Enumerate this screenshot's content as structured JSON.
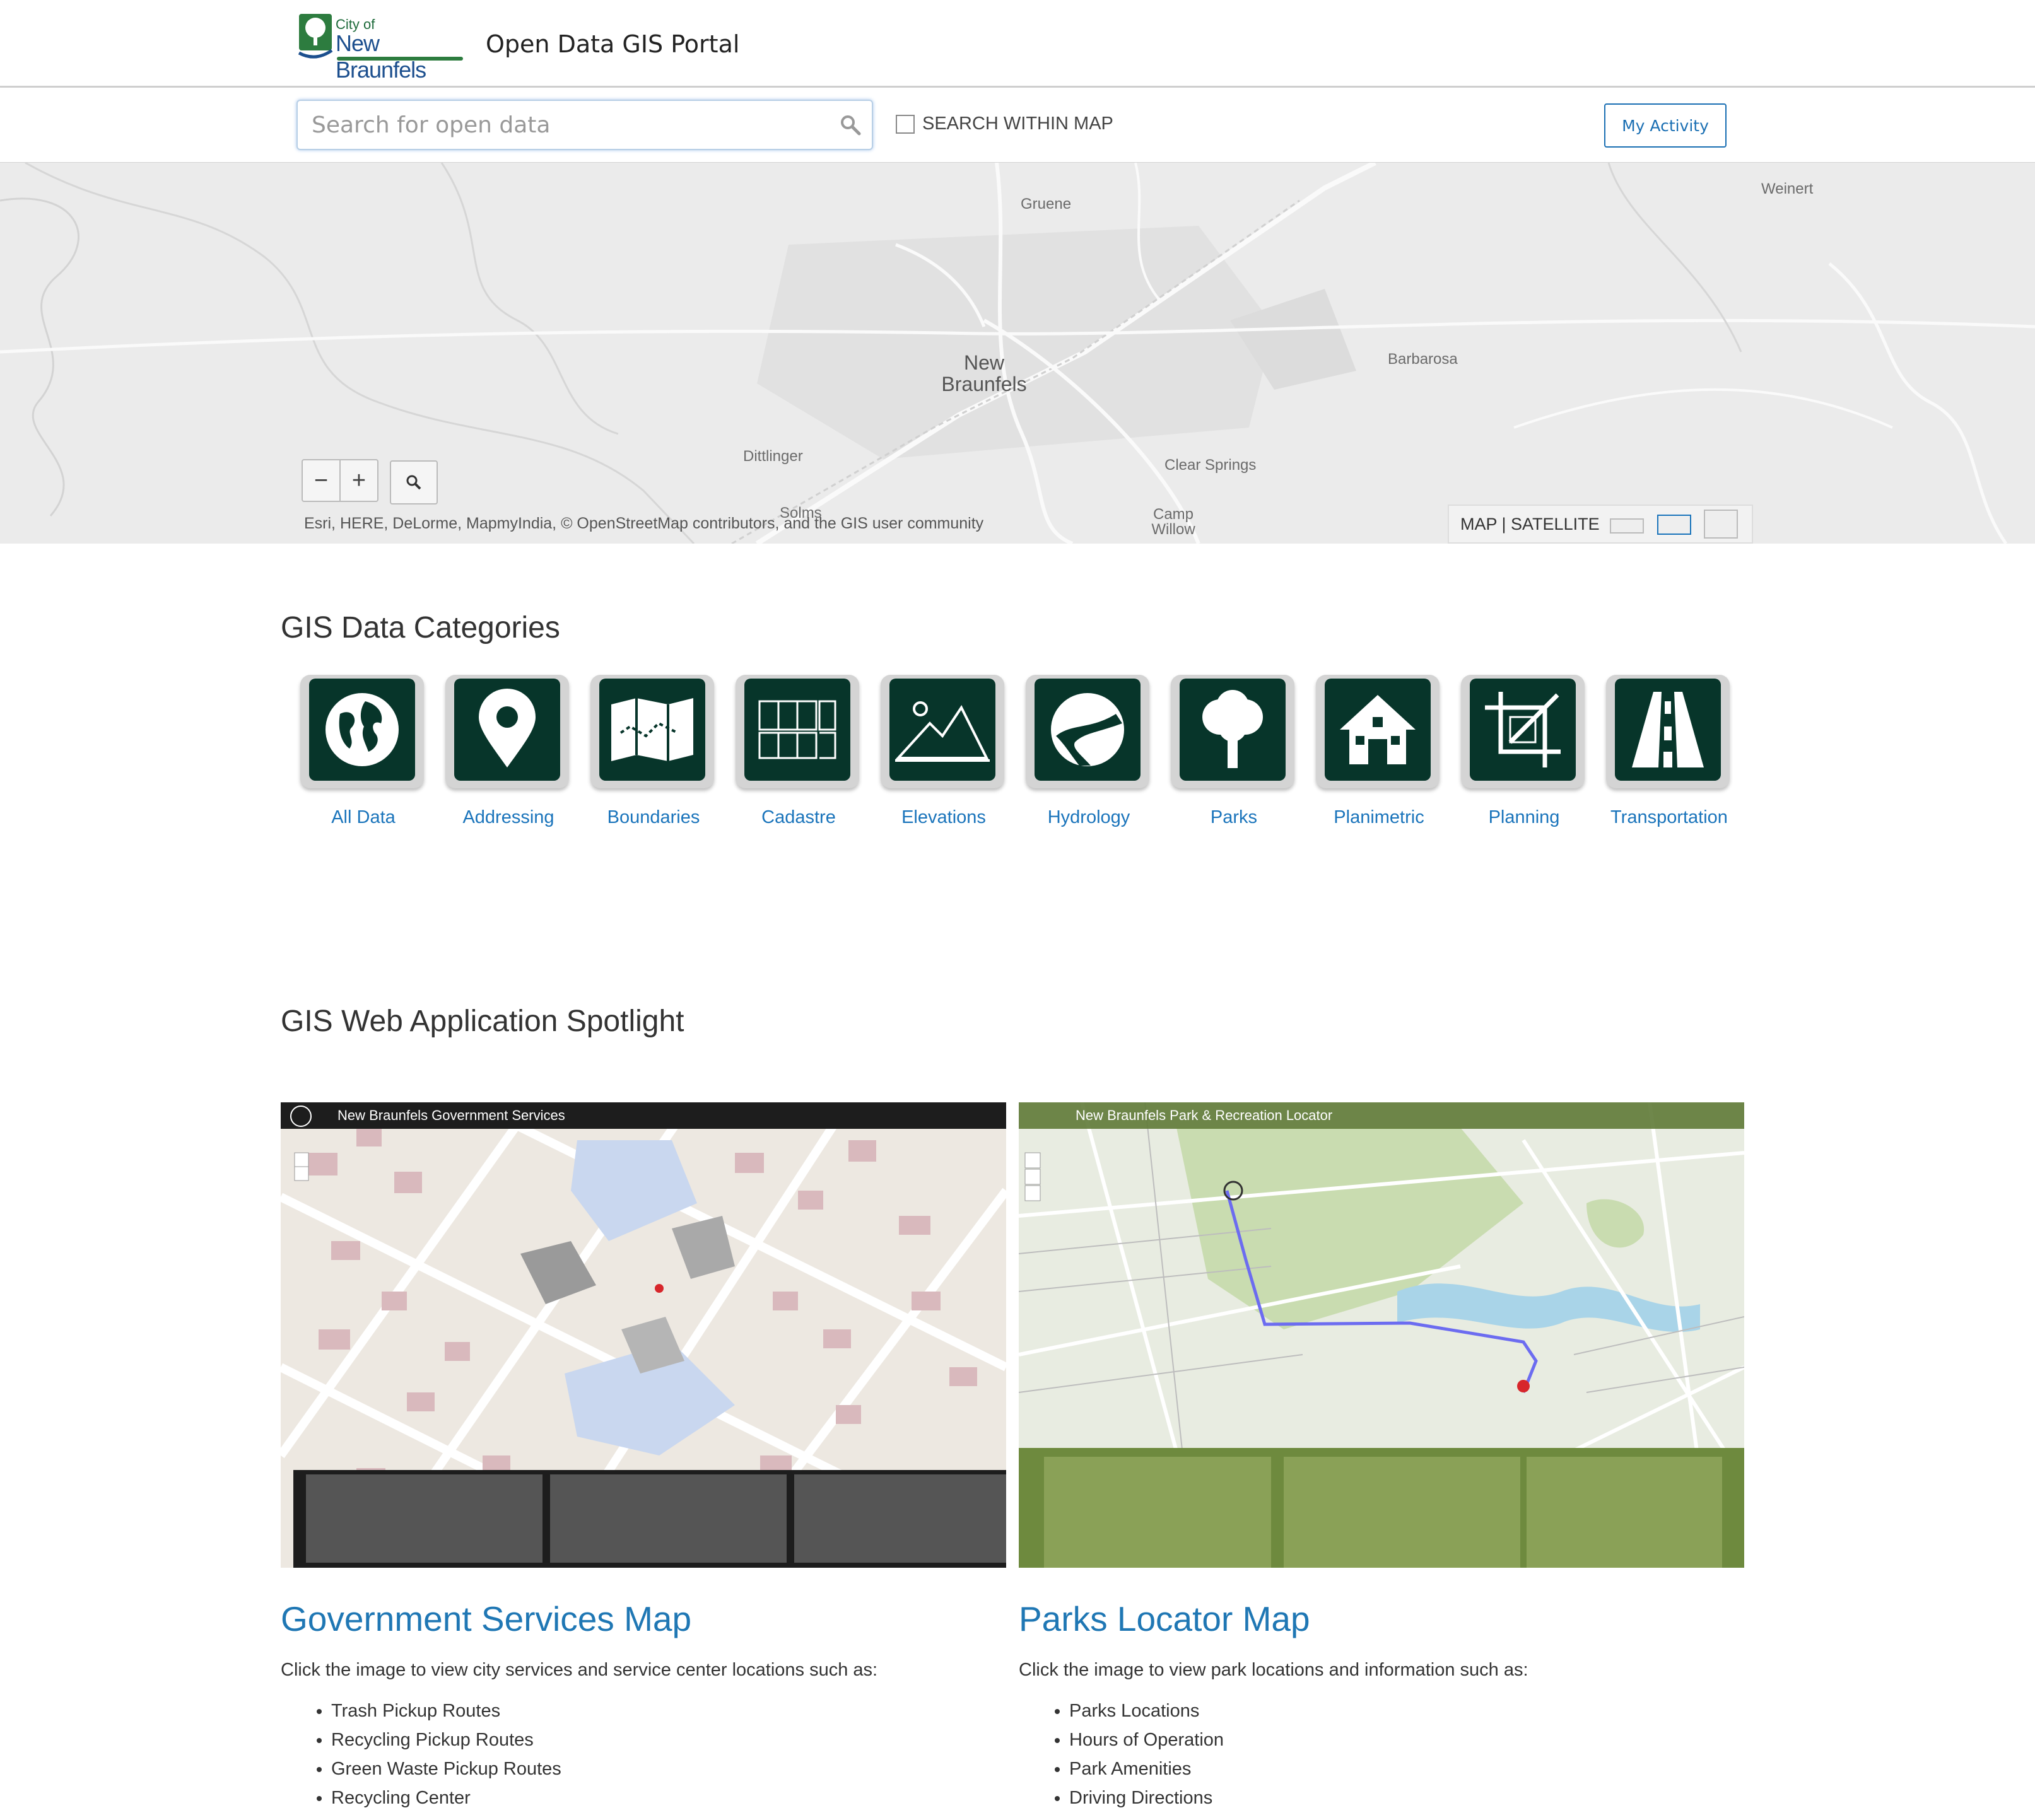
{
  "header": {
    "logo_line1": "City of",
    "logo_line2": "New Braunfels",
    "title": "Open Data GIS Portal"
  },
  "search": {
    "placeholder": "Search for open data",
    "within_map_label": "SEARCH WITHIN MAP",
    "my_activity_label": "My Activity"
  },
  "map": {
    "places": [
      "Gruene",
      "Weinert",
      "New Braunfels",
      "Barbarosa",
      "Dittlinger",
      "Clear Springs",
      "Solms",
      "Camp Willow"
    ],
    "zoom_out": "−",
    "zoom_in": "+",
    "attribution": "Esri, HERE, DeLorme, MapmyIndia, © OpenStreetMap contributors, and the GIS user community",
    "basemap_toggle": "MAP | SATELLITE"
  },
  "categories": {
    "title": "GIS Data Categories",
    "items": [
      {
        "label": "All Data",
        "icon": "globe-icon"
      },
      {
        "label": "Addressing",
        "icon": "map-pin-icon"
      },
      {
        "label": "Boundaries",
        "icon": "folded-map-icon"
      },
      {
        "label": "Cadastre",
        "icon": "parcel-grid-icon"
      },
      {
        "label": "Elevations",
        "icon": "mountain-icon"
      },
      {
        "label": "Hydrology",
        "icon": "river-icon"
      },
      {
        "label": "Parks",
        "icon": "tree-icon"
      },
      {
        "label": "Planimetric",
        "icon": "house-icon"
      },
      {
        "label": "Planning",
        "icon": "crop-icon"
      },
      {
        "label": "Transportation",
        "icon": "road-icon"
      }
    ]
  },
  "spotlight": {
    "title": "GIS Web Application Spotlight",
    "apps": [
      {
        "screenshot_title": "New Braunfels Government Services",
        "title": "Government Services Map",
        "description": "Click the image to view city services and service center locations such as:",
        "items": [
          "Trash Pickup Routes",
          "Recycling Pickup Routes",
          "Green Waste Pickup Routes",
          "Recycling Center"
        ]
      },
      {
        "screenshot_title": "New Braunfels Park & Recreation Locator",
        "title": "Parks Locator Map",
        "description": "Click the image to view park locations and information such as:",
        "items": [
          "Parks Locations",
          "Hours of Operation",
          "Park Amenities",
          "Driving Directions"
        ]
      }
    ]
  }
}
